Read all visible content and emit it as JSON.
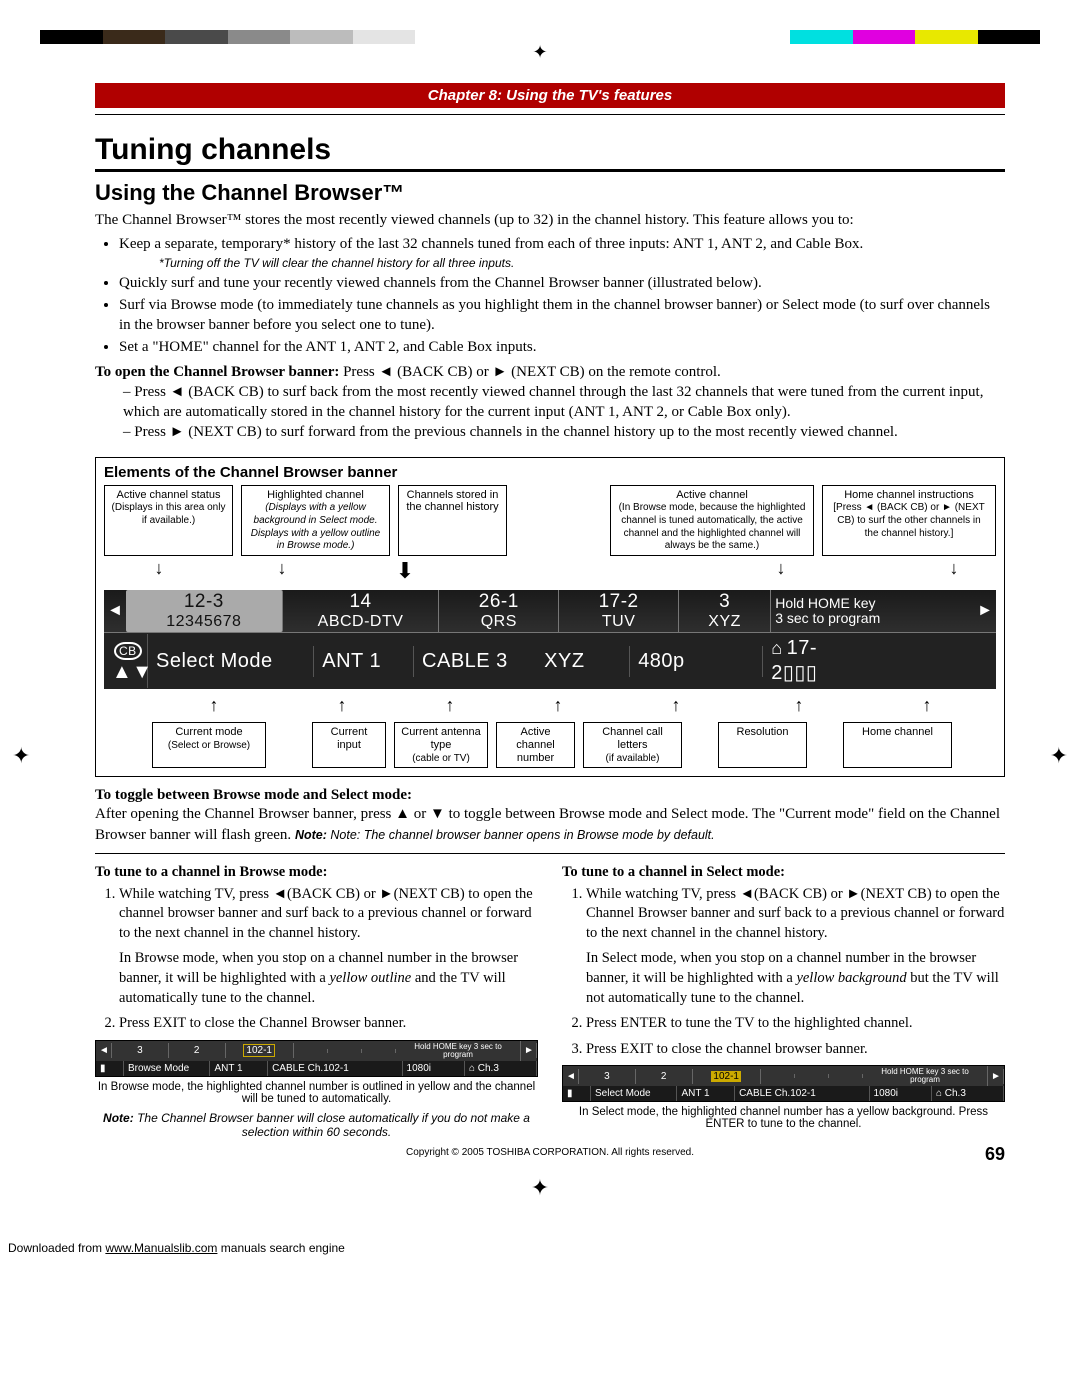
{
  "colorbar": [
    "#000",
    "#3a2a1a",
    "#4a4a4a",
    "#8a8a8a",
    "#bcbcbc",
    "#e4e4e4",
    "#fff",
    "#fff",
    "#fff",
    "#fff",
    "#fff",
    "#fff",
    "#00e0e0",
    "#e000e0",
    "#e8e800",
    "#000"
  ],
  "chapter": "Chapter 8: Using the TV's features",
  "h1": "Tuning channels",
  "h2": "Using the Channel Browser™",
  "intro": "The Channel Browser™ stores the most recently viewed channels (up to 32) in the channel history. This feature allows you to:",
  "bullets": {
    "b1": "Keep a separate, temporary* history of the last 32 channels tuned from each of three inputs: ANT 1, ANT 2, and Cable Box.",
    "b1_note": "*Turning off the TV will clear the channel history for all three inputs.",
    "b2": "Quickly surf and tune your recently viewed channels from the Channel Browser banner (illustrated below).",
    "b3": "Surf via Browse mode (to immediately tune channels as you highlight them in the channel browser banner) or Select mode (to surf over channels in the browser banner before you select one to tune).",
    "b4": "Set a \"HOME\" channel for the ANT 1, ANT 2, and Cable Box inputs."
  },
  "open_lead": "To open the Channel Browser banner:",
  "open_rest": " Press ◄ (BACK CB) or ► (NEXT CB) on the remote control.",
  "dash1": "– Press ◄ (BACK CB) to surf back from the most recently viewed channel through the last 32 channels that were tuned from the current input, which are automatically stored in the channel history for the current input (ANT 1, ANT 2, or Cable Box only).",
  "dash2": "– Press ► (NEXT CB) to surf forward from the previous channels in the channel history up to the most recently viewed channel.",
  "elements_title": "Elements of the Channel Browser banner",
  "top_labels": [
    {
      "t": "Active channel status",
      "s": "(Displays in this area only if available.)"
    },
    {
      "t": "Highlighted channel",
      "s": "(Displays with a yellow background in Select mode. Displays with a yellow outline in Browse mode.)"
    },
    {
      "t": "Channels stored in the channel history",
      "s": ""
    },
    {
      "t": "Active channel",
      "s": "(In Browse mode, because the highlighted channel is tuned automatically, the active channel and the highlighted channel will always be the same.)"
    },
    {
      "t": "Home channel instructions",
      "s": "[Press ◄ (BACK CB) or ► (NEXT CB) to surf the other channels in the channel history.]"
    }
  ],
  "banner_row1": [
    {
      "top": "12-3",
      "bot": "12345678"
    },
    {
      "top": "14",
      "bot": "ABCD-DTV"
    },
    {
      "top": "26-1",
      "bot": "QRS"
    },
    {
      "top": "17-2",
      "bot": "TUV"
    },
    {
      "top": "3",
      "bot": "XYZ"
    },
    {
      "top": "Hold HOME key",
      "bot": "3 sec to program"
    }
  ],
  "banner_row2": {
    "cb": "CB",
    "mode": "Select Mode",
    "input": "ANT 1",
    "cable": "CABLE 3",
    "letters": "XYZ",
    "res": "480p",
    "home": "17-2▯▯▯"
  },
  "bottom_labels": [
    {
      "t": "Current mode",
      "s": "(Select or Browse)"
    },
    {
      "t": "Current input",
      "s": ""
    },
    {
      "t": "Current antenna type",
      "s": "(cable or TV)"
    },
    {
      "t": "Active channel number",
      "s": ""
    },
    {
      "t": "Channel call letters",
      "s": "(if available)"
    },
    {
      "t": "Resolution",
      "s": ""
    },
    {
      "t": "Home channel",
      "s": ""
    }
  ],
  "toggle_heading": "To toggle between Browse mode and Select mode:",
  "toggle_body1": "After opening the Channel Browser banner, press ▲ or ▼ to toggle between Browse mode and Select mode.  The \"Current mode\" field on the Channel Browser banner will flash green. ",
  "toggle_note": "Note: The channel browser banner opens in Browse mode by default.",
  "left": {
    "heading": "To tune to a channel in Browse mode:",
    "s1a": "While watching TV, press ◄(BACK CB) or ►(NEXT CB)  to open the channel browser banner and surf back to a previous channel or forward to the next channel in the channel history.",
    "s1b": "In Browse mode, when you stop on a channel number in the browser banner, it will be highlighted with a ",
    "s1b_i": "yellow outline",
    "s1b_end": " and the TV will automatically tune to the channel.",
    "s2": "Press EXIT to close the Channel Browser banner.",
    "cap": "In Browse mode, the highlighted channel number is outlined in yellow and the channel will be tuned to automatically.",
    "note": "The Channel Browser banner will close automatically if you do not make a selection within 60 seconds.",
    "note_lead": "Note:"
  },
  "right": {
    "heading": "To tune to a channel in Select mode:",
    "s1a": "While watching TV, press ◄(BACK CB) or ►(NEXT CB) to open the Channel Browser banner and surf back to a previous channel or forward to the next channel in the channel history.",
    "s1b": "In Select mode, when you stop on a channel number in the browser banner, it will be highlighted with a ",
    "s1b_i": "yellow background",
    "s1b_end": " but the TV will not automatically tune to the channel.",
    "s2": "Press ENTER to tune the TV to the highlighted channel.",
    "s3": "Press EXIT to close the channel browser banner.",
    "cap": "In Select mode, the highlighted channel number has a yellow background. Press ENTER to tune to the channel."
  },
  "mini": {
    "cells_top": [
      "◄",
      "3",
      "2",
      "102-1",
      "",
      "",
      "",
      "Hold HOME key\n3 sec to program",
      "►"
    ],
    "cells_bot_browse": [
      "▮",
      "Browse Mode",
      "ANT 1",
      "CABLE Ch.102-1",
      "1080i",
      "⌂ Ch.3"
    ],
    "cells_bot_select": [
      "▮",
      "Select Mode",
      "ANT 1",
      "CABLE Ch.102-1",
      "1080i",
      "⌂ Ch.3"
    ]
  },
  "copyright": "Copyright © 2005 TOSHIBA CORPORATION. All rights reserved.",
  "page_num": "69",
  "download": {
    "pre": "Downloaded from ",
    "link": "www.Manualslib.com",
    "post": " manuals search engine"
  }
}
